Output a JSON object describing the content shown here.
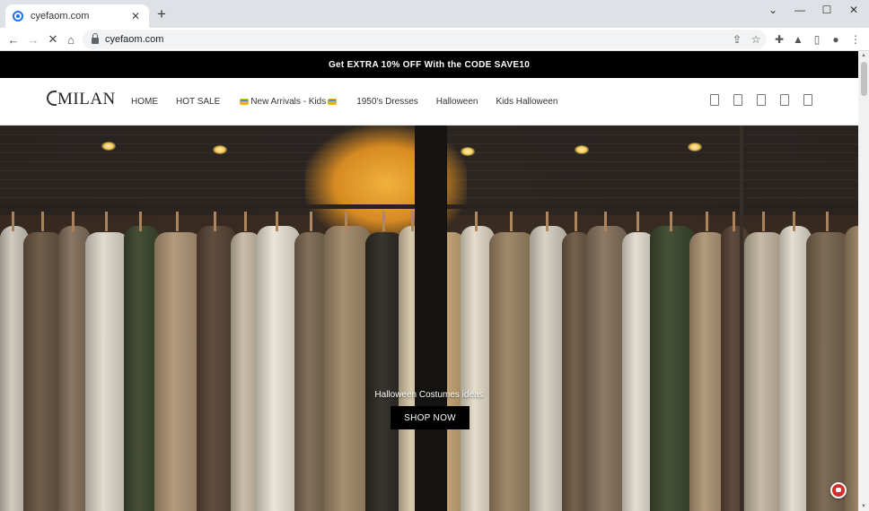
{
  "browser": {
    "tab_title": "cyefaom.com",
    "tab_close": "✕",
    "new_tab": "+",
    "url": "cyefaom.com",
    "window_controls": {
      "collapse": "⌄",
      "minimize": "—",
      "maximize": "☐",
      "close": "✕"
    },
    "nav": {
      "back": "←",
      "forward": "→",
      "stop": "✕",
      "home": "⌂"
    },
    "toolbar_icons": [
      "share-icon",
      "star-icon",
      "extensions-icon",
      "labs-icon",
      "sidepanel-icon",
      "profile-icon",
      "menu-icon"
    ]
  },
  "promo": {
    "text": "Get EXTRA 10% OFF With the CODE SAVE10"
  },
  "header": {
    "logo": "MILAN",
    "menu": [
      {
        "label": "HOME"
      },
      {
        "label": "HOT SALE"
      },
      {
        "label": "New Arrivals - Kids"
      },
      {
        "label": "1950's Dresses"
      },
      {
        "label": "Halloween"
      },
      {
        "label": "Kids Halloween"
      }
    ],
    "icons": [
      "search-icon",
      "account-icon",
      "wishlist-icon",
      "compare-icon",
      "cart-icon"
    ]
  },
  "hero": {
    "caption": "Halloween Costumes ideas",
    "button": "SHOP NOW"
  },
  "colors": {
    "promo_bg": "#000000",
    "button_bg": "#000000",
    "chat_accent": "#d52b2b"
  }
}
